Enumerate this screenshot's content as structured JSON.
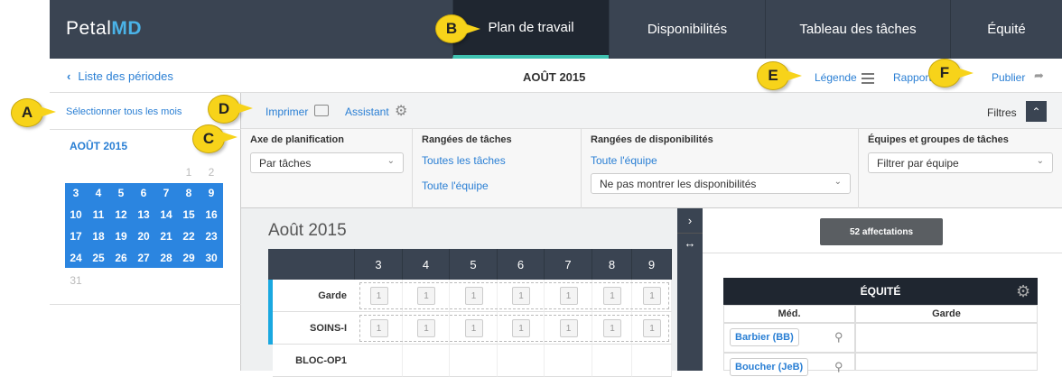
{
  "brand": {
    "name_part1": "Petal",
    "name_part2": "MD"
  },
  "nav": {
    "items": [
      "Plan de travail",
      "Disponibilités",
      "Tableau des tâches",
      "Équité"
    ]
  },
  "subbar": {
    "back_link": "Liste des périodes",
    "period_title": "AOÛT 2015",
    "legend": "Légende",
    "reports": "Rapports",
    "publish": "Publier"
  },
  "left": {
    "select_all": "Sélectionner tous les mois",
    "month": "AOÛT 2015",
    "days_row0": [
      "1",
      "2"
    ],
    "weeks": [
      [
        "3",
        "4",
        "5",
        "6",
        "7",
        "8",
        "9"
      ],
      [
        "10",
        "11",
        "12",
        "13",
        "14",
        "15",
        "16"
      ],
      [
        "17",
        "18",
        "19",
        "20",
        "21",
        "22",
        "23"
      ],
      [
        "24",
        "25",
        "26",
        "27",
        "28",
        "29",
        "30"
      ]
    ],
    "trailing": "31"
  },
  "toolbar": {
    "print": "Imprimer",
    "assistant": "Assistant",
    "filters": "Filtres"
  },
  "filters": {
    "axis": {
      "label": "Axe de planification",
      "value": "Par tâches"
    },
    "task_rows": {
      "label": "Rangées de tâches",
      "link1": "Toutes les tâches",
      "link2": "Toute l'équipe"
    },
    "avail_rows": {
      "label": "Rangées de disponibilités",
      "link1": "Toute l'équipe",
      "value": "Ne pas montrer les disponibilités"
    },
    "teams": {
      "label": "Équipes et groupes de tâches",
      "value": "Filtrer par équipe"
    }
  },
  "calendar": {
    "title": "Août 2015",
    "days": [
      "3",
      "4",
      "5",
      "6",
      "7",
      "8",
      "9"
    ],
    "rows": [
      "Garde",
      "SOINS-I",
      "BLOC-OP1"
    ],
    "slot_value": "1"
  },
  "right": {
    "assignments": "52 affectations",
    "equity_title": "ÉQUITÉ",
    "col_med": "Méd.",
    "col_garde": "Garde",
    "doctors": [
      "Barbier (BB)",
      "Boucher (JeB)"
    ]
  },
  "callouts": [
    "A",
    "B",
    "C",
    "D",
    "E",
    "F"
  ],
  "colors": {
    "nav_bg": "#3a4452",
    "accent_teal": "#3fc1b0",
    "link_blue": "#2a7fd4",
    "calendar_blue": "#2b85e0",
    "callout_yellow": "#f7d31a"
  }
}
